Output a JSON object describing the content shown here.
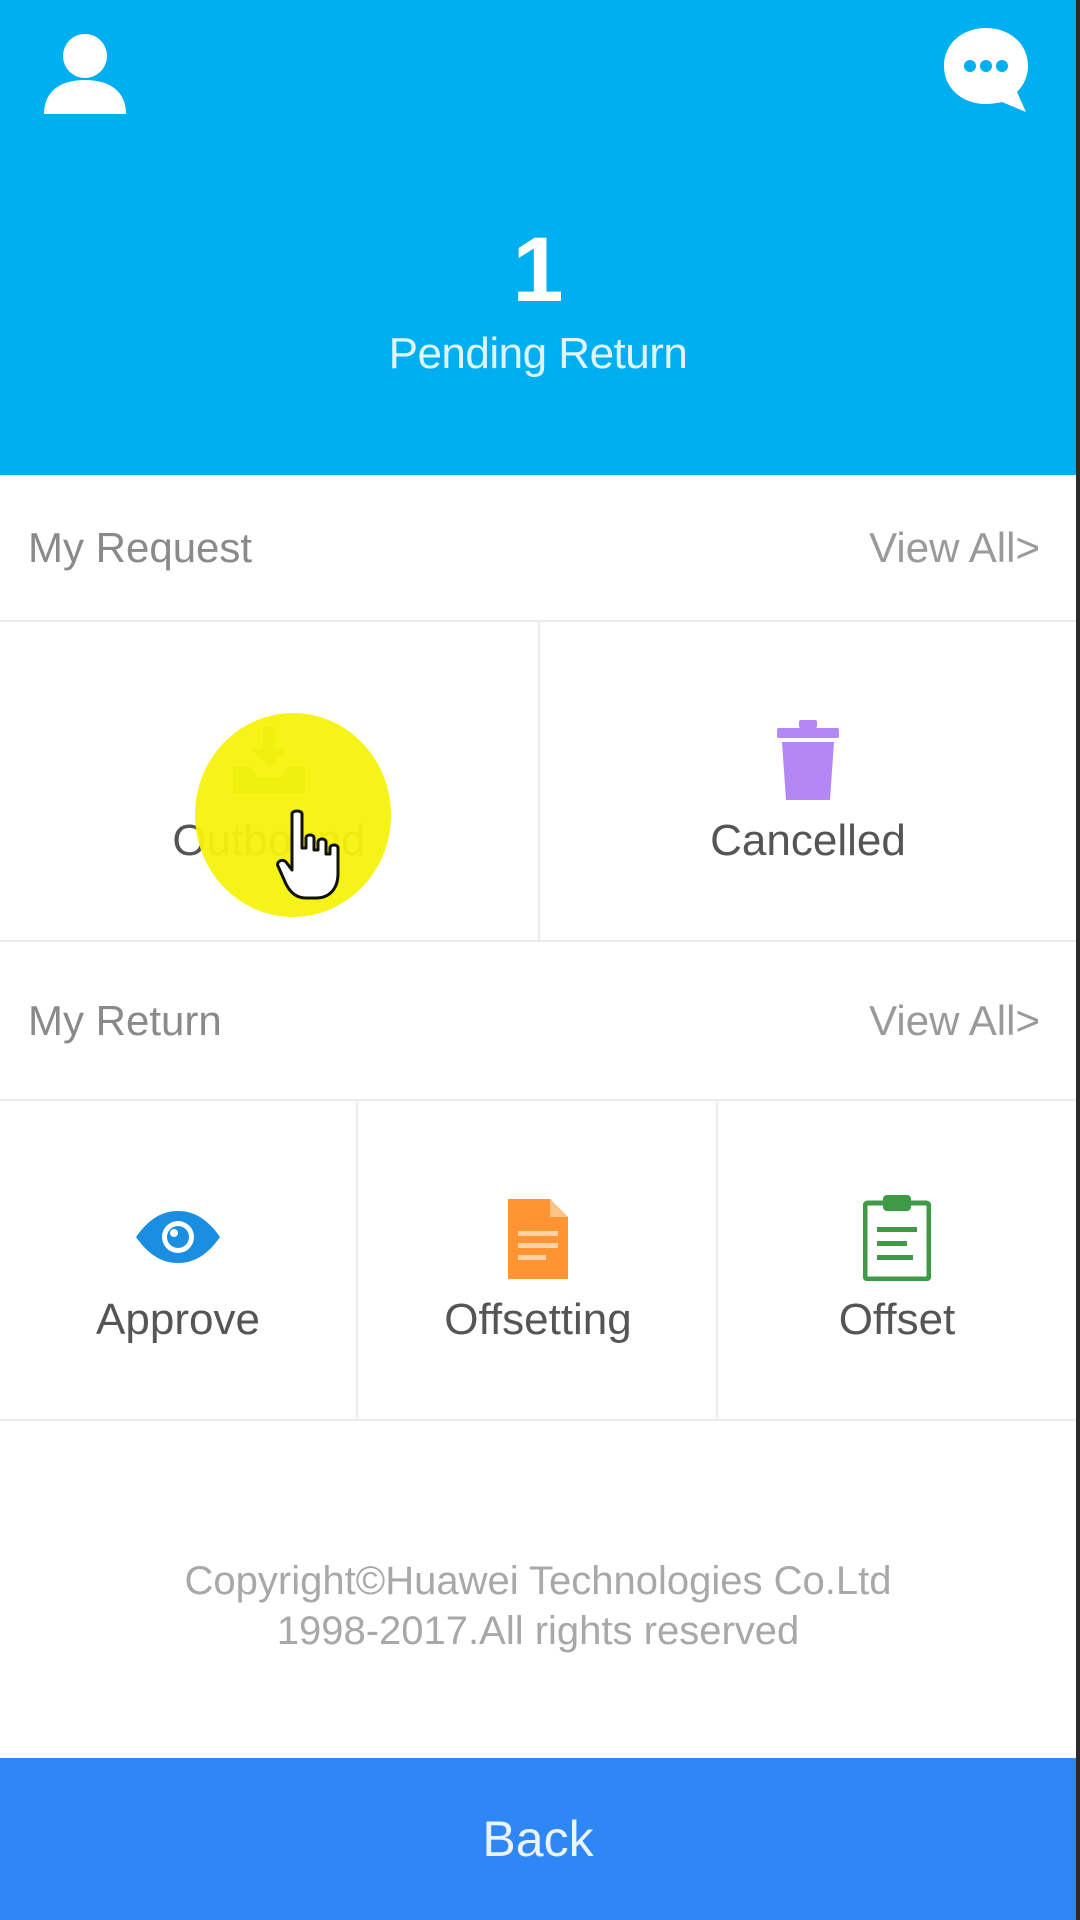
{
  "header": {
    "pending_count": "1",
    "pending_label": "Pending Return",
    "background_color": "#00aff0",
    "left_icon": "user-icon",
    "right_icon": "chat-bubble-icon"
  },
  "my_request": {
    "title": "My Request",
    "view_all": "View All>",
    "items": [
      {
        "label": "Outbound",
        "icon": "download-tray-icon",
        "color": "#4caf50"
      },
      {
        "label": "Cancelled",
        "icon": "trash-icon",
        "color": "#b388f5"
      }
    ]
  },
  "my_return": {
    "title": "My Return",
    "view_all": "View All>",
    "items": [
      {
        "label": "Approve",
        "icon": "eye-icon",
        "color": "#1a8ee0"
      },
      {
        "label": "Offsetting",
        "icon": "document-icon",
        "color": "#ff9433"
      },
      {
        "label": "Offset",
        "icon": "clipboard-icon",
        "color": "#3f9a48"
      }
    ]
  },
  "footer": {
    "copyright_line1": "Copyright©Huawei Technologies Co.Ltd",
    "copyright_line2": "1998-2017.All rights reserved"
  },
  "back": {
    "label": "Back",
    "color": "#2f86f5"
  }
}
